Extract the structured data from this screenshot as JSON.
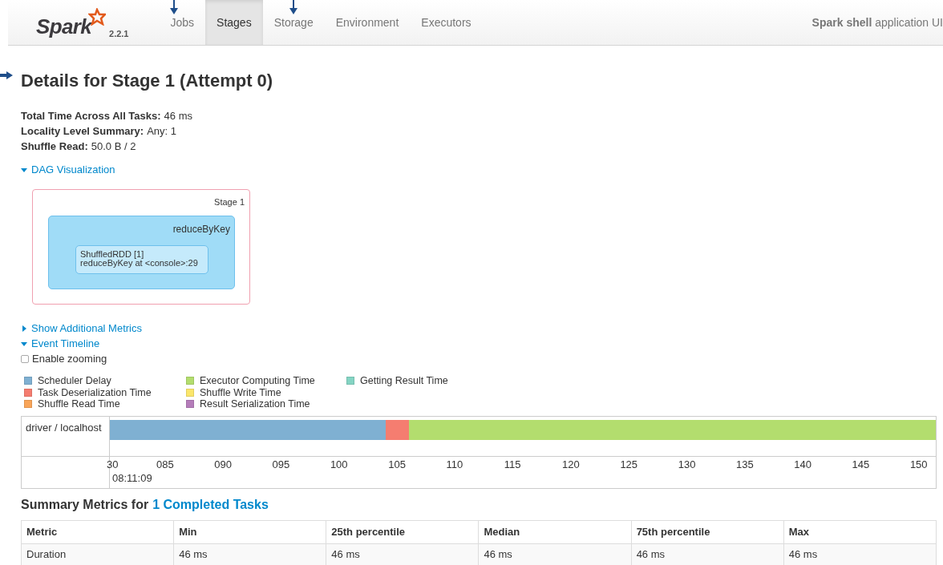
{
  "navbar": {
    "logo_text": "Spark",
    "logo_version": "2.2.1",
    "tabs": [
      {
        "label": "Jobs",
        "selected": false
      },
      {
        "label": "Stages",
        "selected": true
      },
      {
        "label": "Storage",
        "selected": false
      },
      {
        "label": "Environment",
        "selected": false
      },
      {
        "label": "Executors",
        "selected": false
      }
    ],
    "app_name": "**Spark shell** application UI"
  },
  "title": "Details for Stage 1 (Attempt 0)",
  "summary": [
    {
      "label": "Total Time Across All Tasks:",
      "value": "46 ms"
    },
    {
      "label": "Locality Level Summary:",
      "value": "Any: 1"
    },
    {
      "label": "Shuffle Read:",
      "value": "50.0 B / 2"
    }
  ],
  "dag": {
    "toggle": "DAG Visualization",
    "expanded": true,
    "stage_label": "Stage 1",
    "op_label": "reduceByKey",
    "rdd_lines": [
      "ShuffledRDD [1]",
      "reduceByKey at <console>:29"
    ]
  },
  "additional_metrics": {
    "toggle": "Show Additional Metrics",
    "expanded": false
  },
  "event_timeline": {
    "toggle": "Event Timeline",
    "expanded": true,
    "zoom_label": "Enable zooming",
    "zoom_checked": false,
    "legend": [
      {
        "label": "Scheduler Delay",
        "color": "#7fb0d2"
      },
      {
        "label": "Task Deserialization Time",
        "color": "#f57d70"
      },
      {
        "label": "Shuffle Read Time",
        "color": "#f9a55a"
      },
      {
        "label": "Executor Computing Time",
        "color": "#b3dd6e"
      },
      {
        "label": "Shuffle Write Time",
        "color": "#fbe66b"
      },
      {
        "label": "Result Serialization Time",
        "color": "#b57dba"
      },
      {
        "label": "Getting Result Time",
        "color": "#84d4c3"
      }
    ],
    "row_label": "driver / localhost",
    "segments": [
      {
        "color": "#7fb0d2"
      },
      {
        "color": "#f57d70"
      },
      {
        "color": "#b3dd6e"
      }
    ],
    "ticks": [
      "30",
      "085",
      "090",
      "095",
      "100",
      "105",
      "110",
      "115",
      "120",
      "125",
      "130",
      "135",
      "140",
      "145",
      "150"
    ],
    "time": "08:11:09"
  },
  "summary_metrics": {
    "heading": "Summary Metrics for",
    "link": "1 Completed Tasks",
    "columns": [
      "Metric",
      "Min",
      "25th percentile",
      "Median",
      "75th percentile",
      "Max"
    ],
    "rows": [
      [
        "Duration",
        "46 ms",
        "46 ms",
        "46 ms",
        "46 ms",
        "46 ms"
      ]
    ]
  }
}
